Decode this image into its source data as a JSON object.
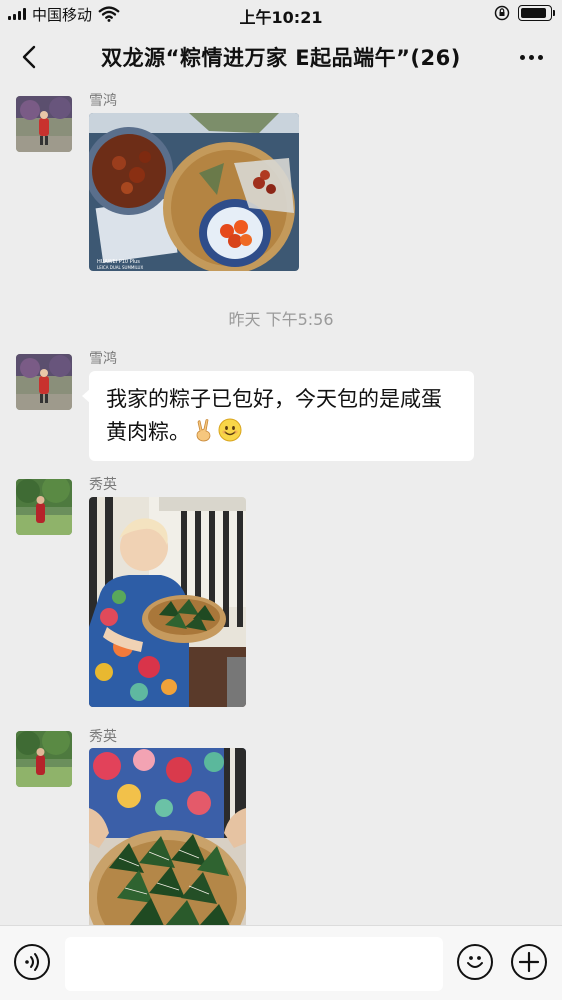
{
  "status_bar": {
    "carrier": "中国移动",
    "time": "上午10:21",
    "battery_level": 0.9
  },
  "nav": {
    "title": "双龙源“粽情进万家 E起品端午”(26)",
    "back_icon": "chevron-left-icon",
    "more_icon": "more-dots-icon"
  },
  "messages": [
    {
      "sender": "雪鸿",
      "type": "image",
      "image_caption": "HUAWEI P10 Plus\nLEICA DUAL SUMMILUX",
      "image_description": "table with a plate of braised meat, bamboo basket with salted egg yolks and zongzi"
    },
    {
      "type": "timestamp",
      "text": "昨天 下午5:56"
    },
    {
      "sender": "雪鸿",
      "type": "text",
      "text": "我家的粽子已包好，今天包的是咸蛋黄肉粽。",
      "emojis": [
        "victory-hand-emoji",
        "smiling-face-emoji"
      ]
    },
    {
      "sender": "秀英",
      "type": "image",
      "image_description": "woman holding a basket of zongzi"
    },
    {
      "sender": "秀英",
      "type": "image",
      "image_description": "close-up of zongzi in a bamboo basket"
    }
  ],
  "input_bar": {
    "placeholder": "",
    "voice_icon": "voice-icon",
    "emoji_icon": "emoji-icon",
    "plus_icon": "plus-icon"
  }
}
